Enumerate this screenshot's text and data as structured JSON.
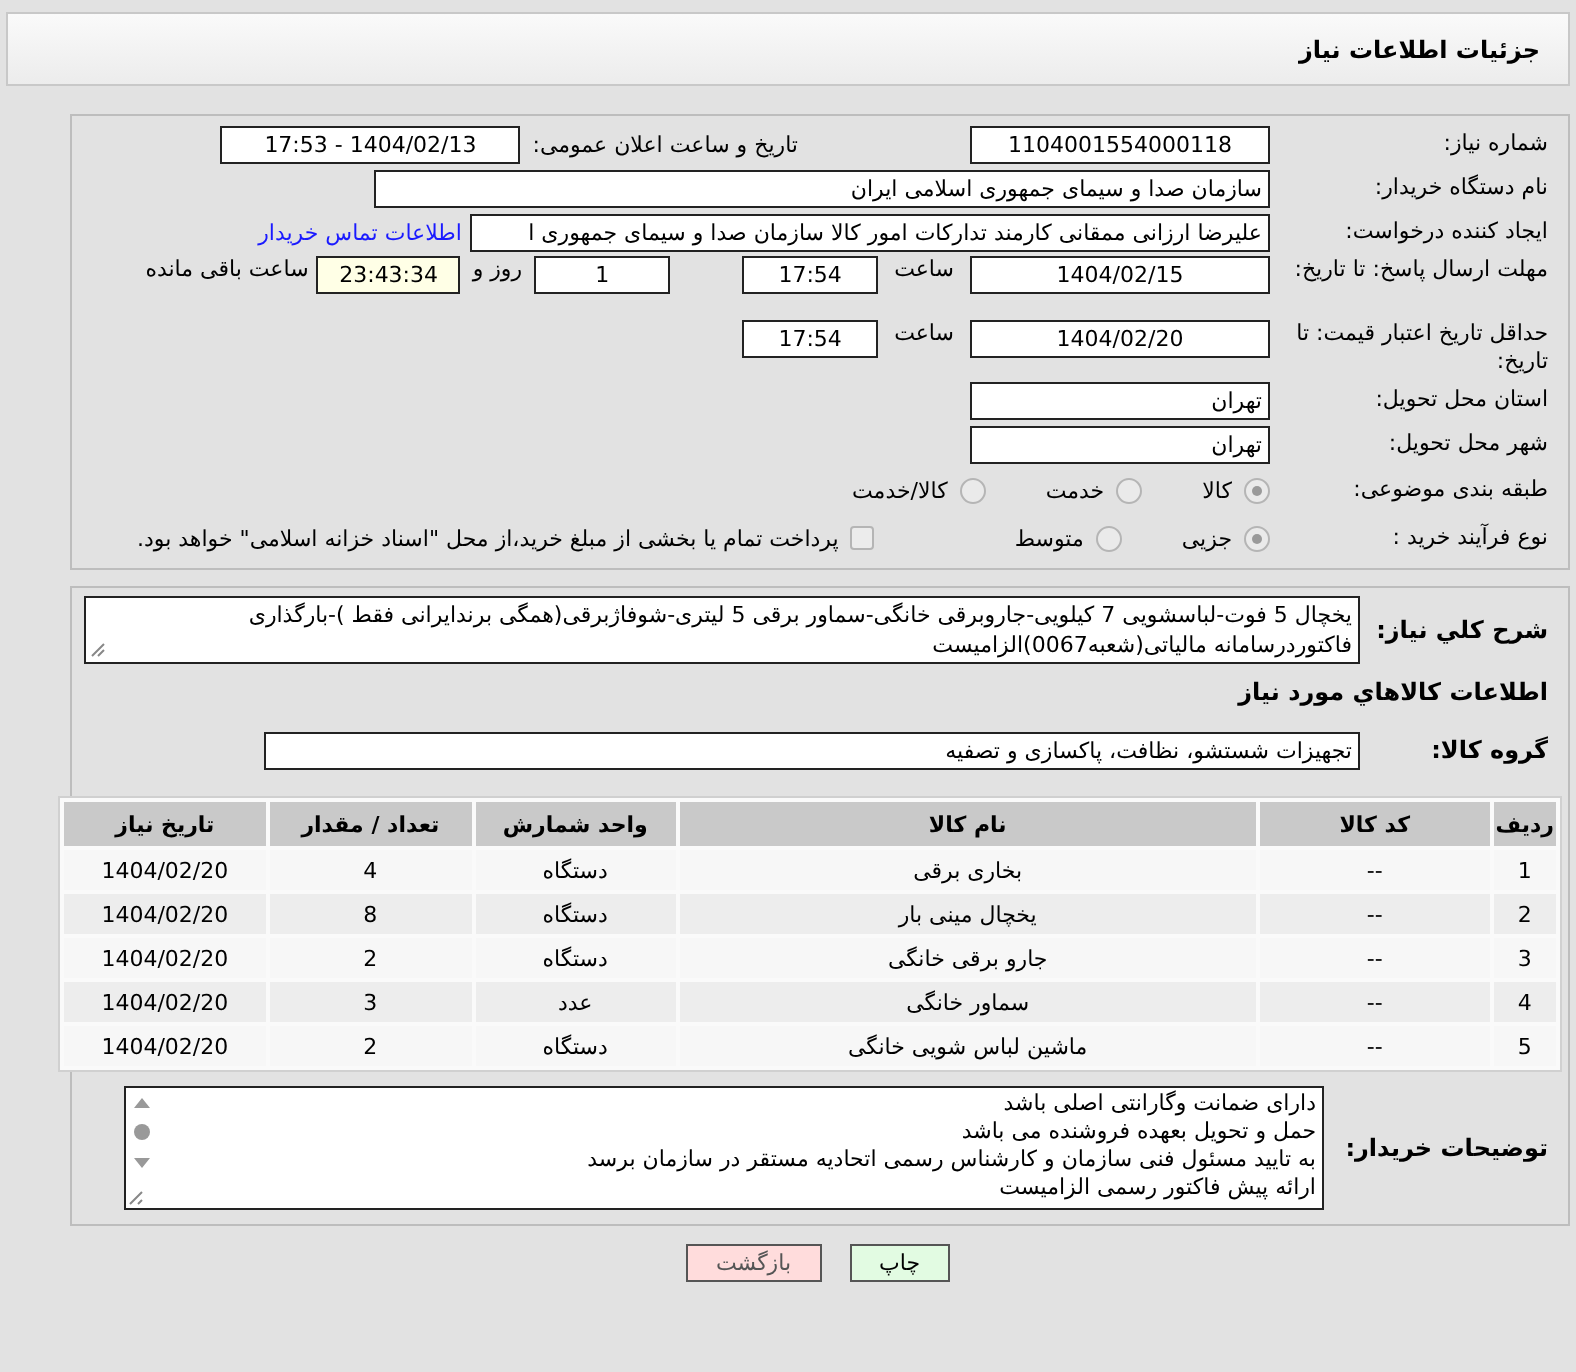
{
  "header": {
    "title": "جزئیات اطلاعات نیاز"
  },
  "need_number": {
    "label": "شماره نیاز:",
    "value": "1104001554000118"
  },
  "announce": {
    "label": "تاریخ و ساعت اعلان عمومی:",
    "value": "1404/02/13 - 17:53"
  },
  "buyer_org": {
    "label": "نام دستگاه خریدار:",
    "value": "سازمان صدا و سیمای جمهوری اسلامی ایران"
  },
  "requester": {
    "label": "ایجاد کننده درخواست:",
    "value": "علیرضا ارزانی ممقانی کارمند تدارکات امور کالا سازمان صدا و سیمای جمهوری ا",
    "link": "اطلاعات تماس خریدار"
  },
  "deadline": {
    "label": "مهلت ارسال پاسخ: تا تاریخ:",
    "date": "1404/02/15",
    "time_label": "ساعت",
    "time": "17:54",
    "days": "1",
    "days_label": "روز و",
    "remaining": "23:43:34",
    "remaining_label": "ساعت باقی مانده"
  },
  "validity": {
    "label": "حداقل تاریخ اعتبار قیمت: تا تاریخ:",
    "date": "1404/02/20",
    "time_label": "ساعت",
    "time": "17:54"
  },
  "province": {
    "label": "استان محل تحویل:",
    "value": "تهران"
  },
  "city": {
    "label": "شهر محل تحویل:",
    "value": "تهران"
  },
  "category": {
    "label": "طبقه بندی موضوعی:",
    "options": [
      {
        "label": "کالا",
        "selected": true
      },
      {
        "label": "خدمت",
        "selected": false
      },
      {
        "label": "کالا/خدمت",
        "selected": false
      }
    ]
  },
  "process": {
    "label": "نوع فرآیند خرید :",
    "options": [
      {
        "label": "جزیی",
        "selected": true
      },
      {
        "label": "متوسط",
        "selected": false
      }
    ],
    "payment": {
      "label": "پرداخت تمام یا بخشی از مبلغ خرید،از محل \"اسناد خزانه اسلامی\" خواهد بود.",
      "checked": false
    }
  },
  "description": {
    "label": "شرح کلي نیاز:",
    "value": "یخچال 5 فوت-لباسشویی 7 کیلویی-جاروبرقی خانگی-سماور برقی 5 لیتری-شوفاژبرقی(همگی برندایرانی فقط )-بارگذاری فاکتوردرسامانه مالیاتی(شعبه0067)الزامیست"
  },
  "items_heading": "اطلاعات کالاهاي مورد نیاز",
  "goods_group": {
    "label": "گروه کالا:",
    "value": "تجهیزات شستشو، نظافت، پاکسازی و تصفیه"
  },
  "table": {
    "columns": [
      "ردیف",
      "کد کالا",
      "نام کالا",
      "واحد شمارش",
      "تعداد / مقدار",
      "تاریخ نیاز"
    ],
    "rows": [
      [
        "1",
        "--",
        "بخاری برقی",
        "دستگاه",
        "4",
        "1404/02/20"
      ],
      [
        "2",
        "--",
        "یخچال مینی بار",
        "دستگاه",
        "8",
        "1404/02/20"
      ],
      [
        "3",
        "--",
        "جارو برقی خانگی",
        "دستگاه",
        "2",
        "1404/02/20"
      ],
      [
        "4",
        "--",
        "سماور خانگی",
        "عدد",
        "3",
        "1404/02/20"
      ],
      [
        "5",
        "--",
        "ماشین لباس شویی خانگی",
        "دستگاه",
        "2",
        "1404/02/20"
      ]
    ]
  },
  "buyer_notes": {
    "label": "توضیحات خریدار:",
    "lines": [
      "دارای ضمانت وگارانتی اصلی باشد",
      "حمل و تحویل بعهده فروشنده می باشد",
      "به تایید مسئول فنی سازمان و کارشناس رسمی اتحادیه مستقر در سازمان برسد",
      "ارائه پیش فاکتور رسمی الزامیست"
    ]
  },
  "buttons": [
    {
      "label": "چاپ",
      "kind": "print"
    },
    {
      "label": "بازگشت",
      "kind": "back"
    }
  ]
}
